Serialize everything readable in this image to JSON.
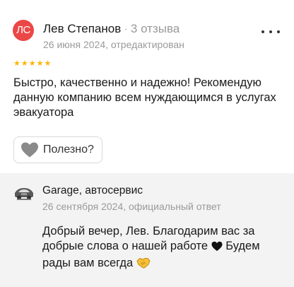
{
  "review": {
    "avatar_initials": "ЛС",
    "avatar_color": "#eb4747",
    "author_name": "Лев Степанов",
    "separator": "·",
    "reviews_count": "3 отзыва",
    "date": "26 июня 2024, отредактирован",
    "rating": 5,
    "rating_max": 5,
    "star_color": "#fcb500",
    "text": "Быстро, качественно и надежно! Рекомендую данную компанию всем нуждающимся в услугах эвакуатора",
    "more_icon": "more-dots-icon",
    "helpful_label": "Полезно?",
    "helpful_icon": "heart-icon"
  },
  "reply": {
    "company_name": "Garage, автосервис",
    "company_logo": "car-logo-icon",
    "date": "26 сентября 2024, официальный ответ",
    "text_part1": "Добрый вечер, Лев. Благодарим вас за добрые слова о нашей работе ",
    "text_part2": " Будем рады вам всегда ",
    "emoji_1": "black-heart-icon",
    "emoji_2": "handshake-icon"
  }
}
